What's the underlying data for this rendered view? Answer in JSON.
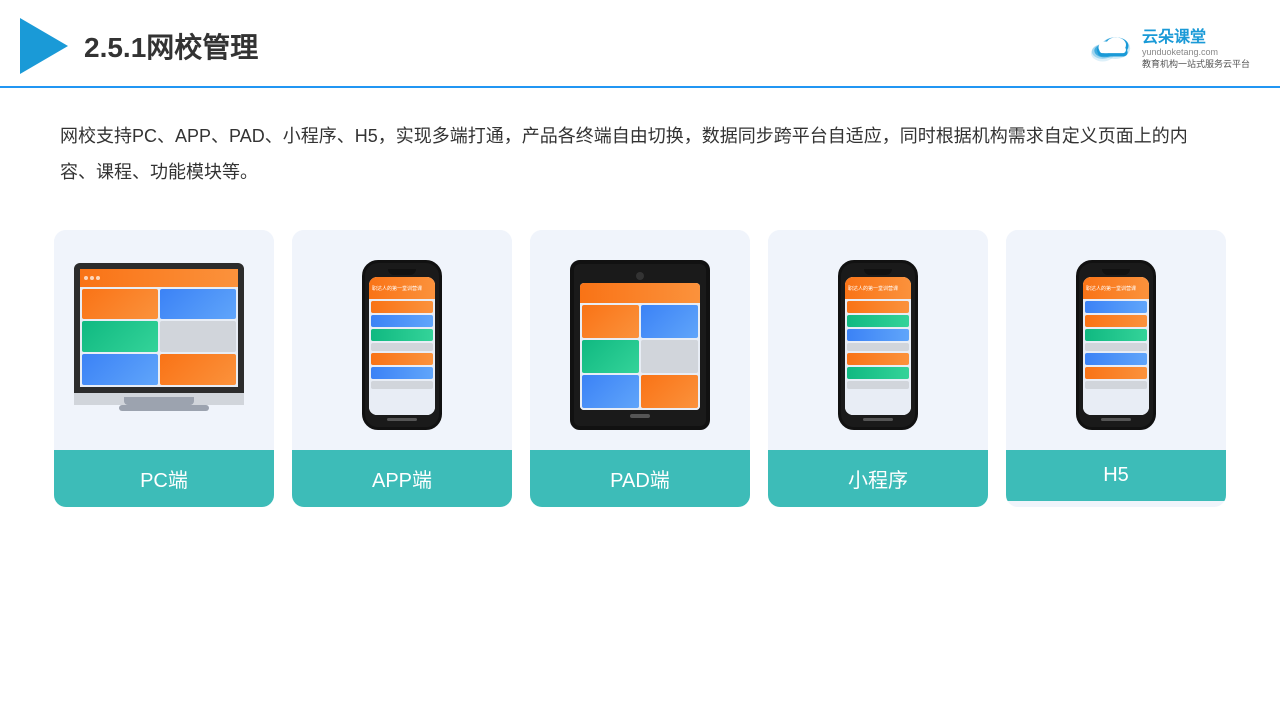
{
  "header": {
    "title": "2.5.1网校管理",
    "brand": {
      "name": "云朵课堂",
      "url": "yunduoketang.com",
      "slogan": "教育机构一站\n式服务云平台"
    }
  },
  "description": {
    "text": "网校支持PC、APP、PAD、小程序、H5，实现多端打通，产品各终端自由切换，数据同步跨平台自适应，同时根据机构需求自定义页面上的内容、课程、功能模块等。"
  },
  "cards": [
    {
      "id": "pc",
      "label": "PC端",
      "device_type": "pc"
    },
    {
      "id": "app",
      "label": "APP端",
      "device_type": "phone"
    },
    {
      "id": "pad",
      "label": "PAD端",
      "device_type": "tablet"
    },
    {
      "id": "miniprogram",
      "label": "小程序",
      "device_type": "phone2"
    },
    {
      "id": "h5",
      "label": "H5",
      "device_type": "phone3"
    }
  ],
  "colors": {
    "accent": "#1a9ad7",
    "card_bg": "#f0f4fb",
    "card_label_bg": "#3dbcb8",
    "header_border": "#2196f3"
  }
}
